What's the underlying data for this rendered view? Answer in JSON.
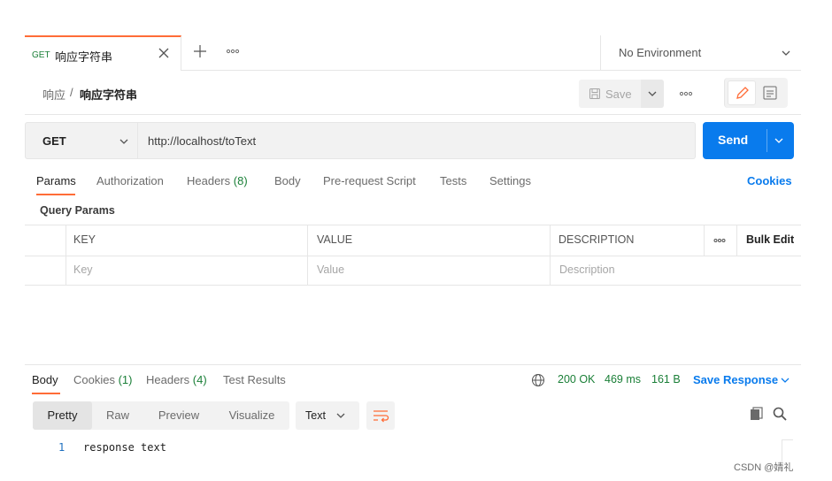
{
  "tab_bar": {
    "active_tab": {
      "method": "GET",
      "name": "响应字符串"
    },
    "environment": "No Environment"
  },
  "breadcrumb": {
    "parent": "响应",
    "separator": "/",
    "current": "响应字符串"
  },
  "toolbar": {
    "save_label": "Save"
  },
  "request": {
    "method": "GET",
    "url": "http://localhost/toText",
    "send_label": "Send"
  },
  "request_tabs": {
    "params": "Params",
    "authorization": "Authorization",
    "headers": "Headers",
    "headers_count": "(8)",
    "body": "Body",
    "pre_request": "Pre-request Script",
    "tests": "Tests",
    "settings": "Settings",
    "cookies": "Cookies"
  },
  "query_params": {
    "title": "Query Params",
    "columns": {
      "key": "KEY",
      "value": "VALUE",
      "description": "DESCRIPTION",
      "bulk_edit": "Bulk Edit"
    },
    "placeholders": {
      "key": "Key",
      "value": "Value",
      "description": "Description"
    }
  },
  "response_tabs": {
    "body": "Body",
    "cookies": "Cookies",
    "cookies_count": "(1)",
    "headers": "Headers",
    "headers_count": "(4)",
    "test_results": "Test Results"
  },
  "response_status": {
    "status": "200 OK",
    "time": "469 ms",
    "size": "161 B",
    "save_response": "Save Response"
  },
  "response_view": {
    "pretty": "Pretty",
    "raw": "Raw",
    "preview": "Preview",
    "visualize": "Visualize",
    "format": "Text"
  },
  "response_body": {
    "lines": [
      {
        "number": "1",
        "text": "response text"
      }
    ]
  },
  "watermark": "CSDN @婧礼",
  "colors": {
    "accent": "#ff6c37",
    "primary": "#097bed",
    "success": "#1a7f37"
  }
}
